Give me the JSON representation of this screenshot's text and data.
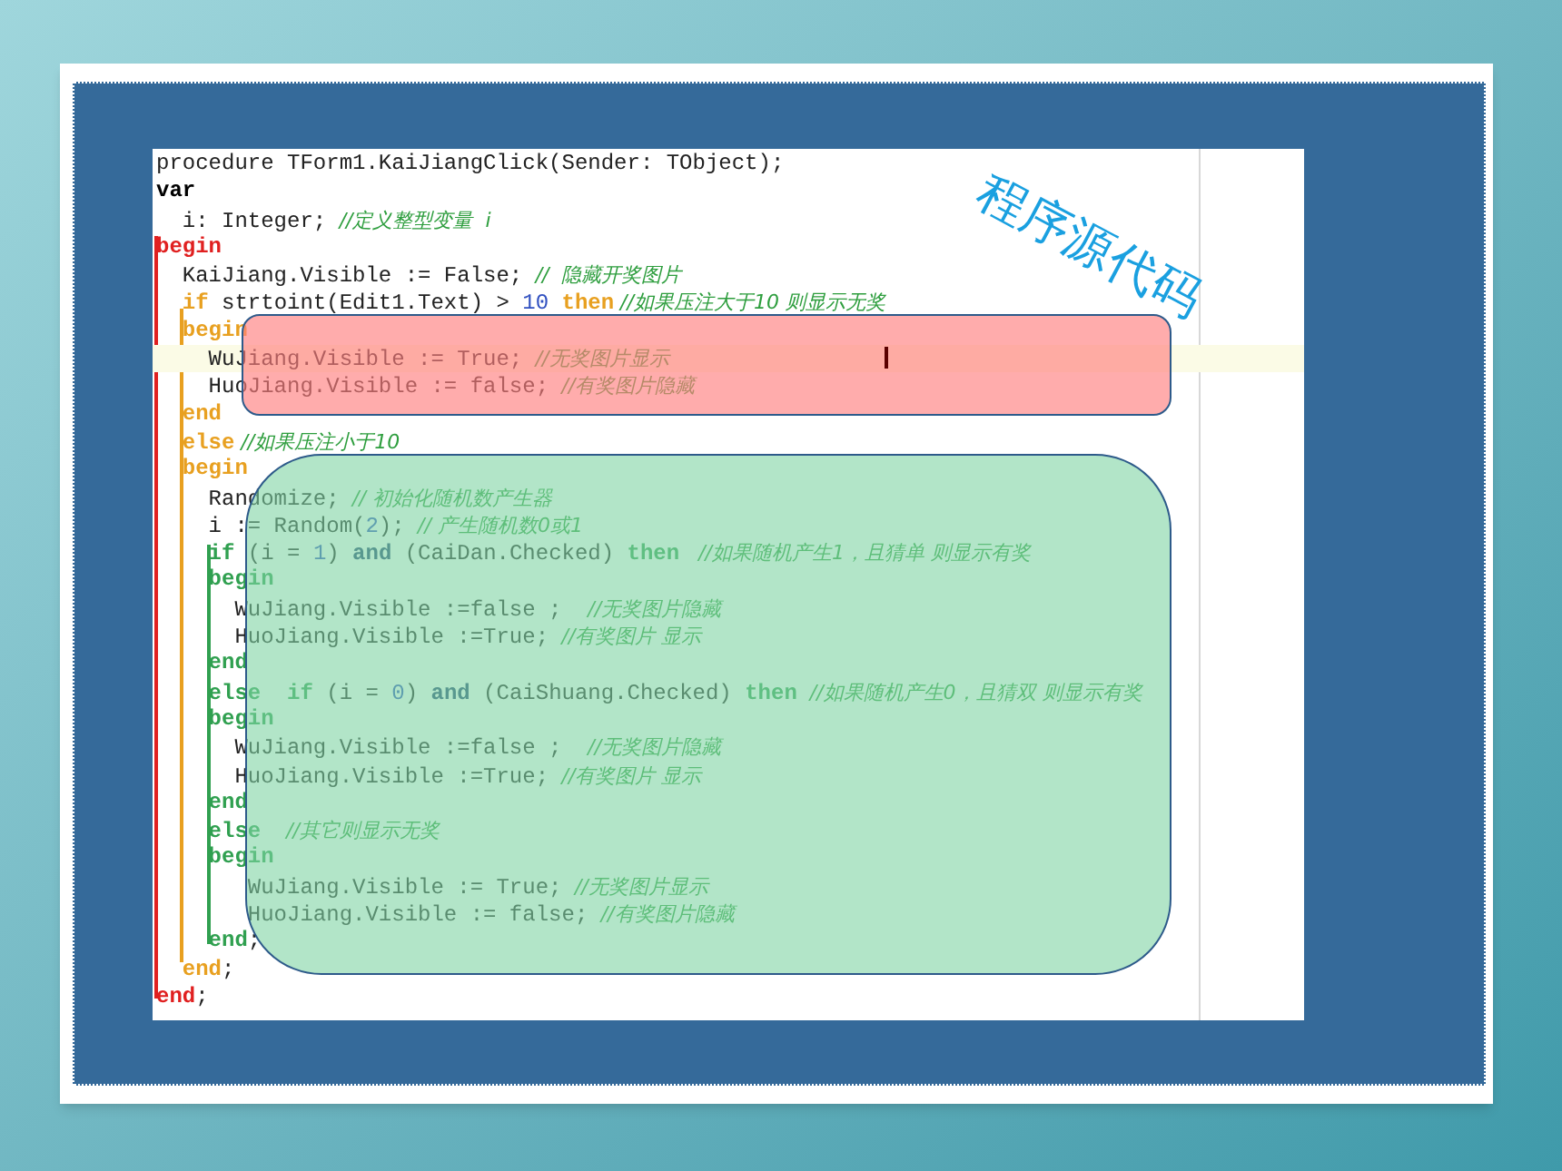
{
  "code_editor": {
    "lines": [
      {
        "current": false,
        "segments": [
          {
            "kind": "plain",
            "text": "procedure TForm1.KaiJiangClick(Sender: TObject);"
          }
        ]
      },
      {
        "current": false,
        "segments": [
          {
            "kind": "declaration",
            "text": "var"
          }
        ]
      },
      {
        "current": false,
        "segments": [
          {
            "kind": "plain",
            "text": "  i: Integer; "
          },
          {
            "kind": "comment",
            "text": "//定义整型变量  i"
          }
        ]
      },
      {
        "current": false,
        "segments": [
          {
            "kind": "outer",
            "text": "begin"
          }
        ]
      },
      {
        "current": false,
        "segments": [
          {
            "kind": "plain",
            "text": "  KaiJiang.Visible := False; "
          },
          {
            "kind": "comment",
            "text": "//  隐藏开奖图片"
          }
        ]
      },
      {
        "current": false,
        "segments": [
          {
            "kind": "middle",
            "text": "  if"
          },
          {
            "kind": "plain",
            "text": " strtoint(Edit1.Text) > "
          },
          {
            "kind": "number",
            "text": "10"
          },
          {
            "kind": "middle",
            "text": " then"
          },
          {
            "kind": "comment",
            "text": " //如果压注大于10 则显示无奖"
          }
        ]
      },
      {
        "current": false,
        "segments": [
          {
            "kind": "middle",
            "text": "  begin"
          }
        ]
      },
      {
        "current": true,
        "segments": [
          {
            "kind": "plain",
            "text": "    WuJiang.Visible := True; "
          },
          {
            "kind": "comment",
            "text": "//无奖图片显示"
          }
        ]
      },
      {
        "current": false,
        "segments": [
          {
            "kind": "plain",
            "text": "    HuoJiang.Visible := false; "
          },
          {
            "kind": "comment",
            "text": "//有奖图片隐藏"
          }
        ]
      },
      {
        "current": false,
        "segments": [
          {
            "kind": "middle",
            "text": "  end"
          }
        ]
      },
      {
        "current": false,
        "segments": [
          {
            "kind": "middle",
            "text": "  else"
          },
          {
            "kind": "comment",
            "text": " //如果压注小于10"
          }
        ]
      },
      {
        "current": false,
        "segments": [
          {
            "kind": "middle",
            "text": "  begin"
          }
        ]
      },
      {
        "current": false,
        "segments": [
          {
            "kind": "plain",
            "text": "    Randomize; "
          },
          {
            "kind": "comment",
            "text": "// 初始化随机数产生器"
          }
        ]
      },
      {
        "current": false,
        "segments": [
          {
            "kind": "plain",
            "text": "    i := Random("
          },
          {
            "kind": "number",
            "text": "2"
          },
          {
            "kind": "plain",
            "text": "); "
          },
          {
            "kind": "comment",
            "text": "// 产生随机数0或1"
          }
        ]
      },
      {
        "current": false,
        "segments": [
          {
            "kind": "inner",
            "text": "    if"
          },
          {
            "kind": "plain",
            "text": " (i = "
          },
          {
            "kind": "number",
            "text": "1"
          },
          {
            "kind": "plain",
            "text": ") "
          },
          {
            "kind": "logic",
            "text": "and"
          },
          {
            "kind": "plain",
            "text": " (CaiDan.Checked) "
          },
          {
            "kind": "inner",
            "text": "then"
          },
          {
            "kind": "comment",
            "text": "   //如果随机产生1，且猜单 则显示有奖"
          }
        ]
      },
      {
        "current": false,
        "segments": [
          {
            "kind": "inner",
            "text": "    begin"
          }
        ]
      },
      {
        "current": false,
        "segments": [
          {
            "kind": "plain",
            "text": "      WuJiang.Visible :=false ;  "
          },
          {
            "kind": "comment",
            "text": "//无奖图片隐藏"
          }
        ]
      },
      {
        "current": false,
        "segments": [
          {
            "kind": "plain",
            "text": "      HuoJiang.Visible :=True; "
          },
          {
            "kind": "comment",
            "text": "//有奖图片 显示"
          }
        ]
      },
      {
        "current": false,
        "segments": [
          {
            "kind": "inner",
            "text": "    end"
          }
        ]
      },
      {
        "current": false,
        "segments": [
          {
            "kind": "inner",
            "text": "    else"
          },
          {
            "kind": "inner",
            "text": "  if"
          },
          {
            "kind": "plain",
            "text": " (i = "
          },
          {
            "kind": "number",
            "text": "0"
          },
          {
            "kind": "plain",
            "text": ") "
          },
          {
            "kind": "logic",
            "text": "and"
          },
          {
            "kind": "plain",
            "text": " (CaiShuang.Checked) "
          },
          {
            "kind": "inner",
            "text": "then"
          },
          {
            "kind": "comment",
            "text": "  //如果随机产生0，且猜双 则显示有奖"
          }
        ]
      },
      {
        "current": false,
        "segments": [
          {
            "kind": "inner",
            "text": "    begin"
          }
        ]
      },
      {
        "current": false,
        "segments": [
          {
            "kind": "plain",
            "text": "      WuJiang.Visible :=false ;  "
          },
          {
            "kind": "comment",
            "text": "//无奖图片隐藏"
          }
        ]
      },
      {
        "current": false,
        "segments": [
          {
            "kind": "plain",
            "text": "      HuoJiang.Visible :=True; "
          },
          {
            "kind": "comment",
            "text": "//有奖图片 显示"
          }
        ]
      },
      {
        "current": false,
        "segments": [
          {
            "kind": "inner",
            "text": "    end"
          }
        ]
      },
      {
        "current": false,
        "segments": [
          {
            "kind": "inner",
            "text": "    else"
          },
          {
            "kind": "comment",
            "text": "    //其它则显示无奖"
          }
        ]
      },
      {
        "current": false,
        "segments": [
          {
            "kind": "inner",
            "text": "    begin"
          }
        ]
      },
      {
        "current": false,
        "segments": [
          {
            "kind": "plain",
            "text": "       WuJiang.Visible := True; "
          },
          {
            "kind": "comment",
            "text": "//无奖图片显示"
          }
        ]
      },
      {
        "current": false,
        "segments": [
          {
            "kind": "plain",
            "text": "       HuoJiang.Visible := false; "
          },
          {
            "kind": "comment",
            "text": "//有奖图片隐藏"
          }
        ]
      },
      {
        "current": false,
        "segments": [
          {
            "kind": "inner",
            "text": "    end"
          },
          {
            "kind": "plain",
            "text": ";"
          }
        ]
      },
      {
        "current": false,
        "segments": [
          {
            "kind": "middle",
            "text": "  end"
          },
          {
            "kind": "plain",
            "text": ";"
          }
        ]
      },
      {
        "current": false,
        "segments": [
          {
            "kind": "outer",
            "text": "end"
          },
          {
            "kind": "plain",
            "text": ";"
          }
        ]
      }
    ]
  },
  "caption": "程序源代码"
}
